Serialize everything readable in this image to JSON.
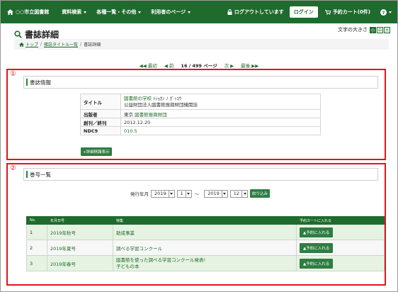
{
  "nav": {
    "brand": "○○市立図書館",
    "menu": [
      "資料検索",
      "各種一覧・その他",
      "利用者のページ"
    ],
    "logout_status": "ログアウトしています",
    "login": "ログイン",
    "cart": "予約カート(0件)",
    "help_icon": "?"
  },
  "page": {
    "title": "書誌詳細",
    "font_size_label": "文字の大きさ",
    "font_sizes": [
      "小",
      "中",
      "大"
    ]
  },
  "breadcrumb": [
    "トップ",
    "雑誌タイトル一覧",
    "書誌詳細"
  ],
  "pager": {
    "first": "最初",
    "prev": "前",
    "position": "16 / 499",
    "page_label": "ページ",
    "next": "次",
    "last": "最後"
  },
  "section1": {
    "marker": "①",
    "heading": "書誌情報",
    "rows": [
      {
        "label": "タイトル",
        "value": "図書館の学校",
        "value_kana": "ﾄｼｮｶﾝ ﾉ ｶﾞｯｺｳ",
        "value2": "公益財団法人図書館振興財団機関誌"
      },
      {
        "label": "出版者",
        "value_prefix": "東京",
        "value": "図書館振興財団"
      },
      {
        "label": "創刊／終刊",
        "value": "2012.12.20"
      },
      {
        "label": "NDC9",
        "value": "010.5"
      }
    ],
    "detail_button": "+詳細情報表示"
  },
  "section2": {
    "marker": "②",
    "heading": "巻号一覧",
    "filter": {
      "label": "発行年月",
      "from_year": "2019",
      "from_month": "1",
      "tilde": "〜",
      "to_year": "2019",
      "to_month": "12",
      "button": "絞り込み"
    },
    "columns": [
      "No.",
      "年月日号",
      "特集",
      "予約カートに入れる"
    ],
    "rows": [
      {
        "no": "1",
        "issue": "2019年秋号",
        "feature": "助成事業",
        "feature2": "",
        "button": "▲予約に入れる"
      },
      {
        "no": "2",
        "issue": "2019年夏号",
        "feature": "調べる学習コンクール",
        "feature2": "",
        "button": "▲予約に入れる"
      },
      {
        "no": "3",
        "issue": "2019年春号",
        "feature": "図書館を使った調べる学習コンクール発表!",
        "feature2": "子どもの本",
        "button": "▲予約に入れる"
      }
    ]
  },
  "colors": {
    "nav_green": "#1f6b2d",
    "highlight_red": "#e0151b",
    "row_green": "#e6f3e2"
  }
}
